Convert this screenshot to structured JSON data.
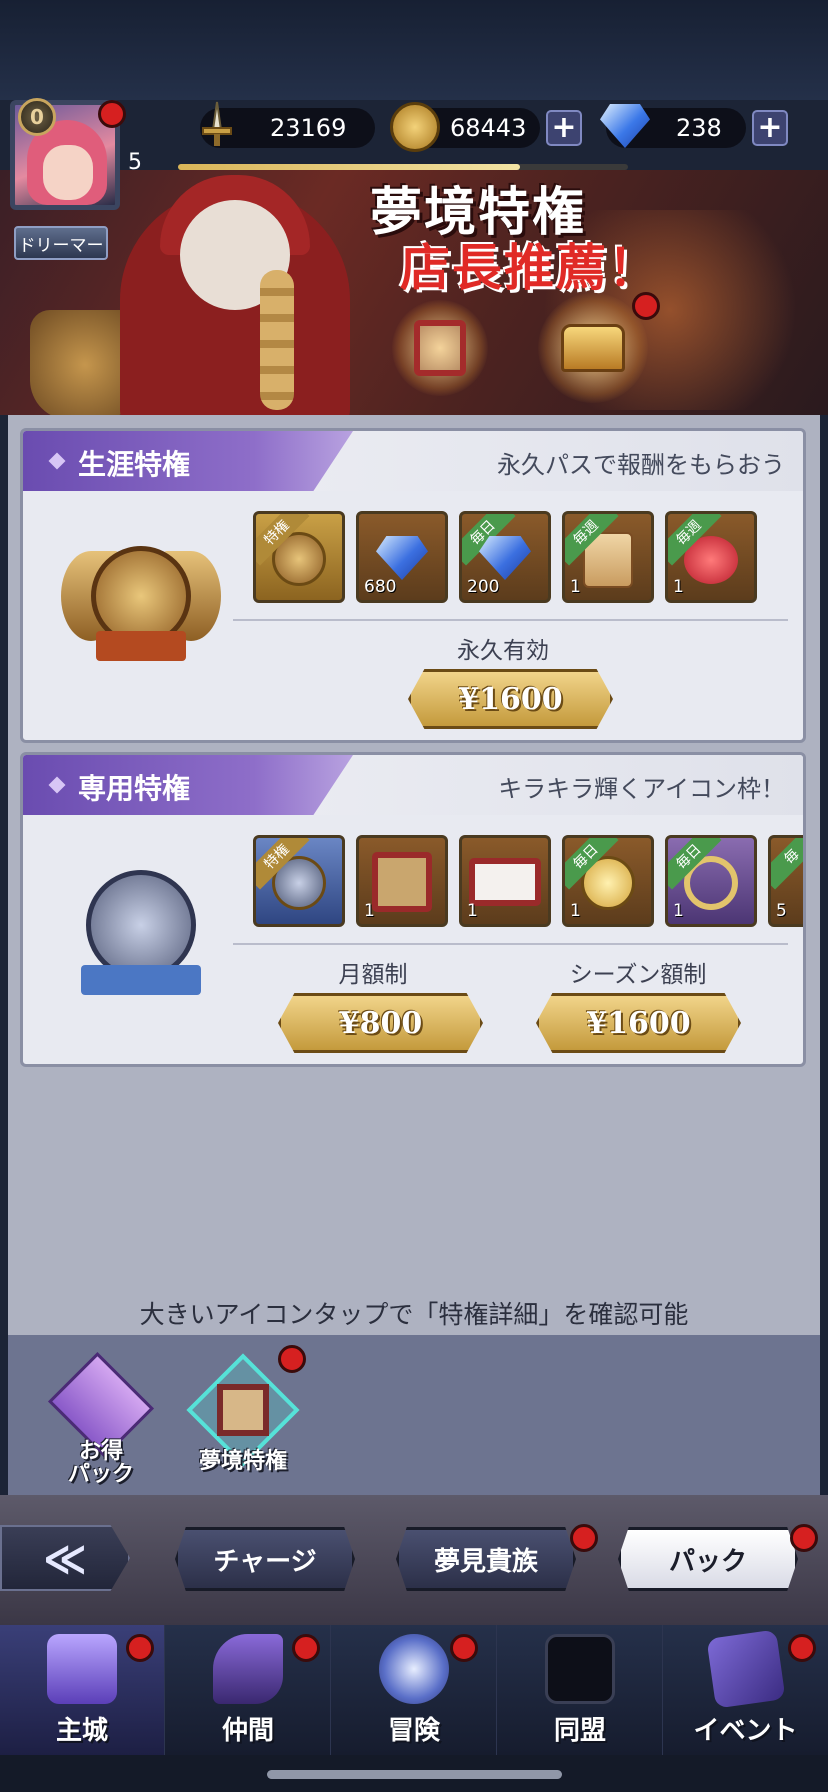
{
  "hud": {
    "player_rank": "0",
    "player_level": "5",
    "title_badge": "ドリーマー",
    "power": "23169",
    "gold": "68443",
    "gems": "238",
    "plus_symbol": "+",
    "exp_progress": 0.76
  },
  "banner": {
    "title_line1": "夢境特権",
    "title_line2": "店長推薦！"
  },
  "lifetime_pass": {
    "tab_title": "生涯特権",
    "subtitle": "永久パスで報酬をもらおう",
    "items": [
      {
        "ribbon": "特権",
        "qty": "",
        "icon": "crest-icon"
      },
      {
        "ribbon": "",
        "qty": "680",
        "icon": "gem-icon"
      },
      {
        "ribbon": "毎日",
        "qty": "200",
        "icon": "gem-icon"
      },
      {
        "ribbon": "毎週",
        "qty": "1",
        "icon": "scroll-icon"
      },
      {
        "ribbon": "毎週",
        "qty": "1",
        "icon": "red-orb-icon"
      }
    ],
    "duration_label": "永久有効",
    "price": "¥1600"
  },
  "exclusive_pass": {
    "tab_title": "専用特権",
    "subtitle": "キラキラ輝くアイコン枠！",
    "items": [
      {
        "ribbon": "特権",
        "qty": "",
        "icon": "anchor-crest-icon"
      },
      {
        "ribbon": "",
        "qty": "1",
        "icon": "avatar-frame-icon"
      },
      {
        "ribbon": "",
        "qty": "1",
        "icon": "name-frame-icon"
      },
      {
        "ribbon": "毎日",
        "qty": "1",
        "icon": "star-medal-icon"
      },
      {
        "ribbon": "毎日",
        "qty": "1",
        "icon": "ring-icon"
      },
      {
        "ribbon": "毎",
        "qty": "5",
        "icon": "partial-item-icon"
      }
    ],
    "monthly_label": "月額制",
    "monthly_price": "¥800",
    "season_label": "シーズン額制",
    "season_price": "¥1600"
  },
  "hint_text": "大きいアイコンタップで「特権詳細」を確認可能",
  "pack_categories": [
    {
      "label": "お得\nパック",
      "icon": "gift-box-icon"
    },
    {
      "label": "夢境特権",
      "icon": "dream-frame-icon"
    }
  ],
  "shop_tabs": {
    "back_icon": "≪",
    "charge": "チャージ",
    "dream_noble": "夢見貴族",
    "pack": "パック"
  },
  "nav": [
    {
      "label": "主城",
      "icon": "castle-icon"
    },
    {
      "label": "仲間",
      "icon": "witch-hat-icon"
    },
    {
      "label": "冒険",
      "icon": "compass-icon"
    },
    {
      "label": "同盟",
      "icon": "lock-icon"
    },
    {
      "label": "イベント",
      "icon": "cards-icon"
    }
  ],
  "colors": {
    "accent_purple": "#7a5cc0",
    "gold": "#c49a3c",
    "notification_red": "#d62020"
  }
}
